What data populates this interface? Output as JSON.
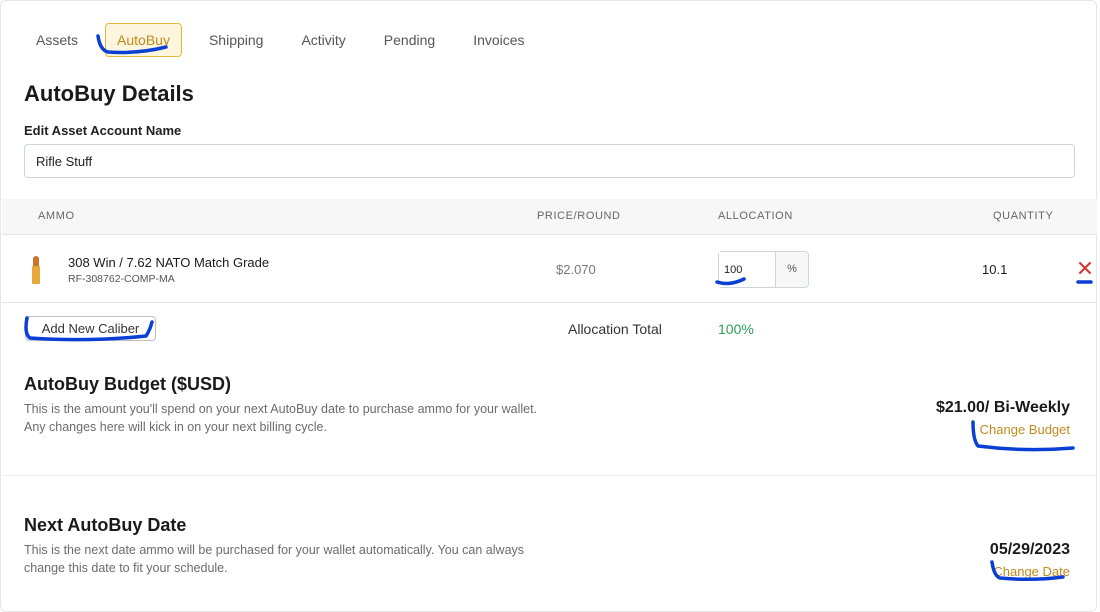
{
  "tabs": [
    {
      "label": "Assets",
      "active": false
    },
    {
      "label": "AutoBuy",
      "active": true
    },
    {
      "label": "Shipping",
      "active": false
    },
    {
      "label": "Activity",
      "active": false
    },
    {
      "label": "Pending",
      "active": false
    },
    {
      "label": "Invoices",
      "active": false
    }
  ],
  "details": {
    "title": "AutoBuy Details",
    "account_label": "Edit Asset Account Name",
    "account_name": "Rifle Stuff"
  },
  "table": {
    "headers": {
      "ammo": "AMMO",
      "price": "PRICE/ROUND",
      "allocation": "ALLOCATION",
      "quantity": "QUANTITY"
    },
    "rows": [
      {
        "icon": "bullet-icon",
        "name": "308 Win / 7.62 NATO Match Grade",
        "sku": "RF-308762-COMP-MA",
        "price": "$2.070",
        "allocation": "100",
        "allocation_suffix": "%",
        "quantity": "10.1",
        "remove_icon": "close-icon"
      }
    ],
    "add_button": "Add New Caliber",
    "allocation_total_label": "Allocation Total",
    "allocation_total_value": "100%"
  },
  "budget": {
    "title": "AutoBuy Budget ($USD)",
    "description": "This is the amount you'll spend on your next AutoBuy date to purchase ammo for your wallet. Any changes here will kick in on your next billing cycle.",
    "value": "$21.00/ Bi-Weekly",
    "link": "Change Budget"
  },
  "next_date": {
    "title": "Next AutoBuy Date",
    "description": "This is the next date ammo will be purchased for your wallet automatically. You can always change this date to fit your schedule.",
    "value": "05/29/2023",
    "link": "Change Date"
  },
  "colors": {
    "accent": "#c08a1d",
    "active_tab_border": "#e0b93a",
    "remove": "#d9302c",
    "success": "#2e9e5b",
    "annotation": "#0a3fd6"
  }
}
